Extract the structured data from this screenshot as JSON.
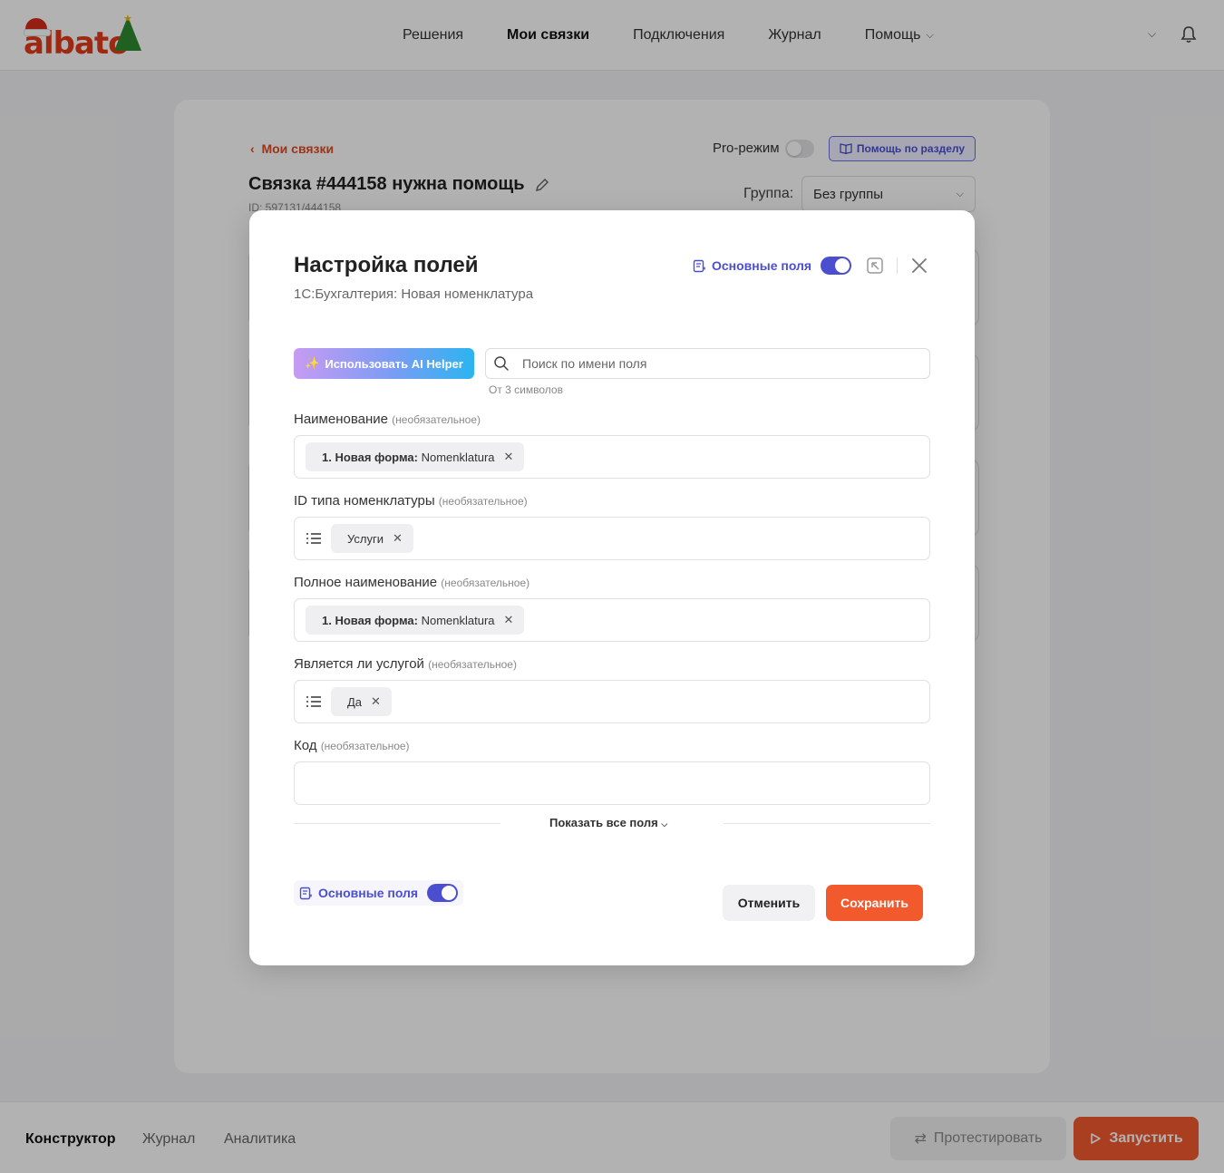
{
  "header": {
    "logo_text": "albato",
    "nav": [
      {
        "label": "Решения"
      },
      {
        "label": "Мои связки"
      },
      {
        "label": "Подключения"
      },
      {
        "label": "Журнал"
      },
      {
        "label": "Помощь"
      }
    ],
    "active_nav": "Мои связки"
  },
  "page": {
    "back_link": "Мои связки",
    "pro_mode_label": "Pro-режим",
    "help_button": "Помощь по разделу",
    "bundle_title": "Связка #444158 нужна помощь",
    "bundle_id": "ID: 597131/444158",
    "group_label": "Группа:",
    "group_value": "Без группы"
  },
  "bottom": {
    "tabs": [
      {
        "label": "Конструктор"
      },
      {
        "label": "Журнал"
      },
      {
        "label": "Аналитика"
      }
    ],
    "test_button": "Протестировать",
    "run_button": "Запустить"
  },
  "modal": {
    "title": "Настройка полей",
    "subtitle": "1С:Бухгалтерия: Новая номенклатура",
    "basic_fields_label": "Основные поля",
    "ai_button": "Использовать AI Helper",
    "search_placeholder": "Поиск по имени поля",
    "search_hint": "От 3 символов",
    "optional": "(необязательное)",
    "fields": [
      {
        "label": "Наименование",
        "chip_bold": "1. Новая форма:",
        "chip_value": "Nomenklatura"
      },
      {
        "label": "ID типа номенклатуры",
        "chip_value": "Услуги"
      },
      {
        "label": "Полное наименование",
        "chip_bold": "1. Новая форма:",
        "chip_value": "Nomenklatura"
      },
      {
        "label": "Является ли услугой",
        "chip_value": "Да"
      },
      {
        "label": "Код"
      }
    ],
    "show_all": "Показать все поля",
    "cancel_button": "Отменить",
    "save_button": "Сохранить"
  },
  "colors": {
    "accent": "#f25a2e",
    "primary": "#4b4fcf",
    "link": "#e04b22"
  }
}
